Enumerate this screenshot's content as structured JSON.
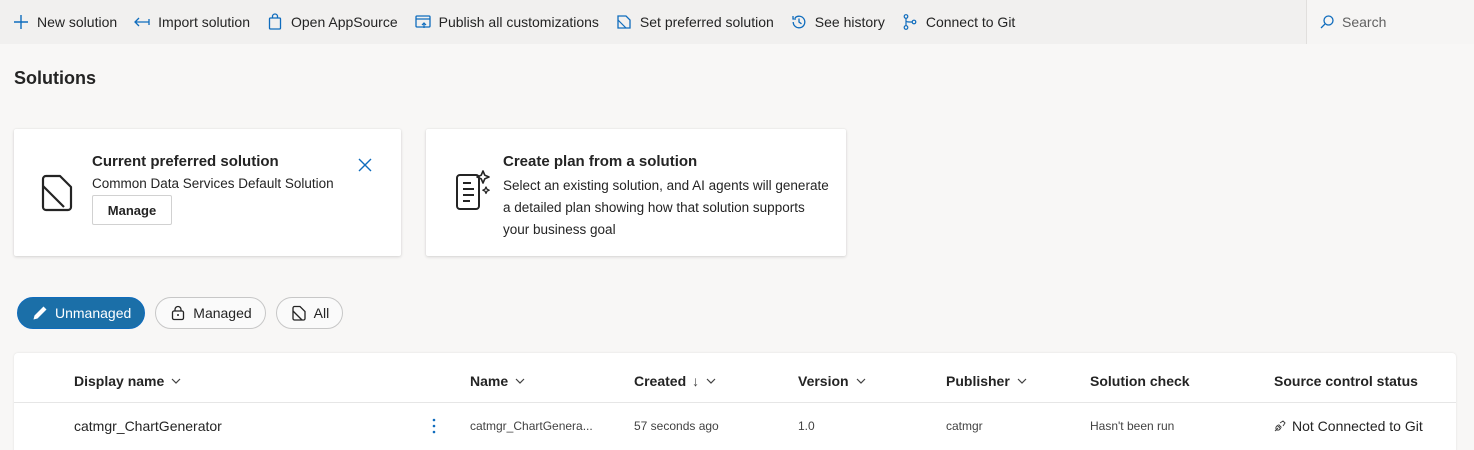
{
  "toolbar": {
    "items": [
      {
        "label": "New solution",
        "icon": "plus-icon"
      },
      {
        "label": "Import solution",
        "icon": "import-arrow-icon"
      },
      {
        "label": "Open AppSource",
        "icon": "shopping-bag-icon"
      },
      {
        "label": "Publish all customizations",
        "icon": "publish-icon"
      },
      {
        "label": "Set preferred solution",
        "icon": "solution-icon"
      },
      {
        "label": "See history",
        "icon": "history-icon"
      },
      {
        "label": "Connect to Git",
        "icon": "git-branch-icon"
      }
    ],
    "search_label": "Search"
  },
  "page": {
    "title": "Solutions"
  },
  "cards": {
    "preferred": {
      "title": "Current preferred solution",
      "subtitle": "Common Data Services Default Solution",
      "button": "Manage"
    },
    "plan": {
      "title": "Create plan from a solution",
      "description": "Select an existing solution, and AI agents will generate a detailed plan showing how that solution supports your business goal"
    }
  },
  "filters": [
    {
      "label": "Unmanaged",
      "active": true,
      "icon": "pencil-icon"
    },
    {
      "label": "Managed",
      "active": false,
      "icon": "lock-icon"
    },
    {
      "label": "All",
      "active": false,
      "icon": "solution-icon"
    }
  ],
  "table": {
    "columns": {
      "display_name": "Display name",
      "name": "Name",
      "created": "Created",
      "created_sort": "↓",
      "version": "Version",
      "publisher": "Publisher",
      "solution_check": "Solution check",
      "source_control": "Source control status"
    },
    "rows": [
      {
        "display_name": "catmgr_ChartGenerator",
        "name": "catmgr_ChartGenera...",
        "created": "57 seconds ago",
        "version": "1.0",
        "publisher": "catmgr",
        "solution_check": "Hasn't been run",
        "source_control": "Not Connected to Git"
      }
    ]
  },
  "colors": {
    "accent": "#1b6fa8",
    "toolbar_bg": "#f1f0ef",
    "page_bg": "#f8f7f6"
  }
}
